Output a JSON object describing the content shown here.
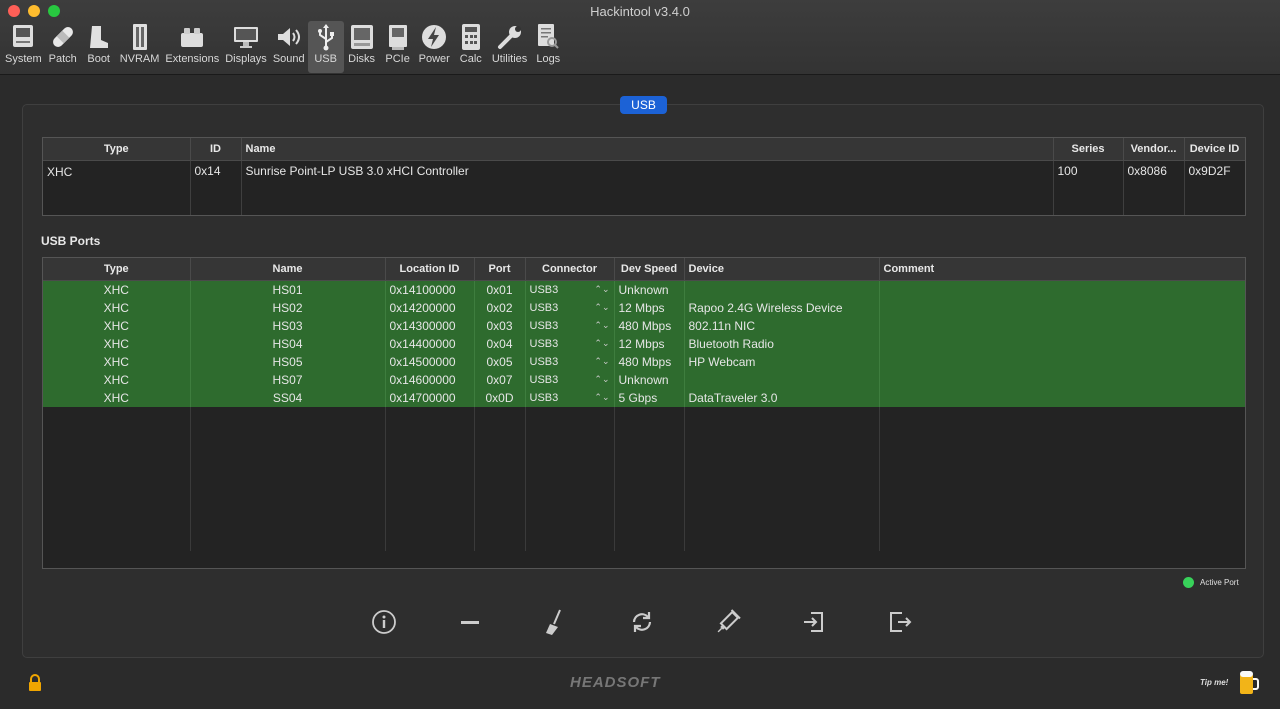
{
  "window": {
    "title": "Hackintool v3.4.0"
  },
  "toolbar": {
    "items": [
      {
        "label": "System",
        "icon": "monitor-icon"
      },
      {
        "label": "Patch",
        "icon": "bandage-icon"
      },
      {
        "label": "Boot",
        "icon": "boot-icon"
      },
      {
        "label": "NVRAM",
        "icon": "memory-chip-icon"
      },
      {
        "label": "Extensions",
        "icon": "lego-brick-icon"
      },
      {
        "label": "Displays",
        "icon": "display-icon"
      },
      {
        "label": "Sound",
        "icon": "speaker-icon"
      },
      {
        "label": "USB",
        "icon": "usb-icon"
      },
      {
        "label": "Disks",
        "icon": "disk-icon"
      },
      {
        "label": "PCIe",
        "icon": "pcie-card-icon"
      },
      {
        "label": "Power",
        "icon": "power-bolt-icon"
      },
      {
        "label": "Calc",
        "icon": "calculator-icon"
      },
      {
        "label": "Utilities",
        "icon": "wrench-icon"
      },
      {
        "label": "Logs",
        "icon": "log-search-icon"
      }
    ],
    "active": "USB"
  },
  "segment": {
    "label": "USB"
  },
  "controllers": {
    "headers": {
      "type": "Type",
      "id": "ID",
      "name": "Name",
      "series": "Series",
      "vendor": "Vendor...",
      "device_id": "Device ID"
    },
    "rows": [
      {
        "type": "XHC",
        "id": "0x14",
        "name": "Sunrise Point-LP USB 3.0 xHCI Controller",
        "series": "100",
        "vendor": "0x8086",
        "device_id": "0x9D2F"
      }
    ]
  },
  "ports": {
    "title": "USB Ports",
    "headers": {
      "type": "Type",
      "name": "Name",
      "location": "Location ID",
      "port": "Port",
      "connector": "Connector",
      "speed": "Dev Speed",
      "device": "Device",
      "comment": "Comment"
    },
    "rows": [
      {
        "type": "XHC",
        "name": "HS01",
        "location": "0x14100000",
        "port": "0x01",
        "connector": "USB3",
        "speed": "Unknown",
        "device": "",
        "comment": ""
      },
      {
        "type": "XHC",
        "name": "HS02",
        "location": "0x14200000",
        "port": "0x02",
        "connector": "USB3",
        "speed": "12 Mbps",
        "device": "Rapoo 2.4G Wireless Device",
        "comment": ""
      },
      {
        "type": "XHC",
        "name": "HS03",
        "location": "0x14300000",
        "port": "0x03",
        "connector": "USB3",
        "speed": "480 Mbps",
        "device": "802.11n NIC",
        "comment": ""
      },
      {
        "type": "XHC",
        "name": "HS04",
        "location": "0x14400000",
        "port": "0x04",
        "connector": "USB3",
        "speed": "12 Mbps",
        "device": "Bluetooth Radio",
        "comment": ""
      },
      {
        "type": "XHC",
        "name": "HS05",
        "location": "0x14500000",
        "port": "0x05",
        "connector": "USB3",
        "speed": "480 Mbps",
        "device": "HP Webcam",
        "comment": ""
      },
      {
        "type": "XHC",
        "name": "HS07",
        "location": "0x14600000",
        "port": "0x07",
        "connector": "USB3",
        "speed": "Unknown",
        "device": "",
        "comment": ""
      },
      {
        "type": "XHC",
        "name": "SS04",
        "location": "0x14700000",
        "port": "0x0D",
        "connector": "USB3",
        "speed": "5 Gbps",
        "device": "DataTraveler 3.0",
        "comment": ""
      }
    ]
  },
  "legend": {
    "label": "Active Port",
    "color": "#38d25a"
  },
  "actions": [
    "info-icon",
    "remove-icon",
    "broom-icon",
    "refresh-icon",
    "syringe-icon",
    "import-icon",
    "export-icon"
  ],
  "footer": {
    "brand": "HEADSOFT",
    "tip": "Tip me!"
  },
  "colors": {
    "accent": "#1c62d6",
    "active_row": "#2e6b2e"
  }
}
